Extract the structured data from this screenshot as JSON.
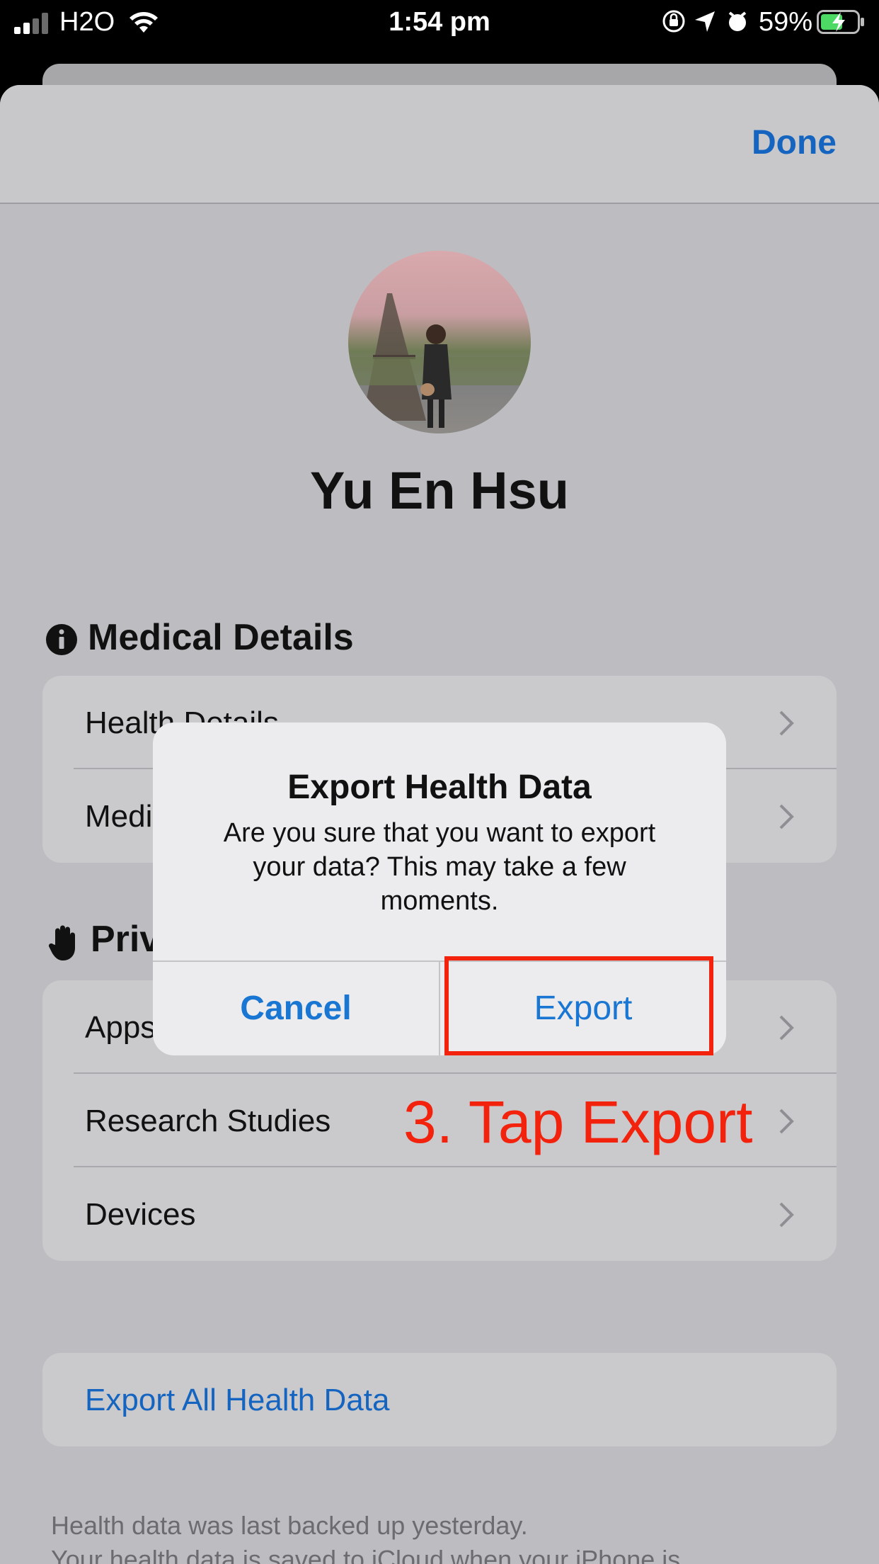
{
  "status_bar": {
    "carrier": "H2O",
    "time": "1:54 pm",
    "battery_percent": "59%",
    "icons": [
      "signal-icon",
      "wifi-icon",
      "rotation-lock-icon",
      "location-icon",
      "alarm-icon",
      "battery-charging-icon"
    ]
  },
  "header": {
    "done_label": "Done"
  },
  "profile": {
    "name": "Yu En Hsu"
  },
  "medical_section": {
    "title": "Medical Details",
    "icon": "info-icon",
    "rows": [
      "Health Details",
      "Medical ID"
    ]
  },
  "privacy_section": {
    "title": "Privacy",
    "icon": "hand-icon",
    "rows": [
      "Apps",
      "Research Studies",
      "Devices"
    ]
  },
  "export_all": {
    "label": "Export All Health Data"
  },
  "footer": {
    "line1": "Health data was last backed up yesterday.",
    "line2": "Your health data is saved to iCloud when your iPhone is"
  },
  "alert": {
    "title": "Export Health Data",
    "message": "Are you sure that you want to export your data? This may take a few moments.",
    "cancel_label": "Cancel",
    "export_label": "Export"
  },
  "annotation": {
    "text": "3. Tap Export",
    "color": "#f2220c"
  },
  "colors": {
    "accent": "#1976d2",
    "sheet_bg": "#bdbdc1",
    "alert_bg": "#ececee"
  }
}
